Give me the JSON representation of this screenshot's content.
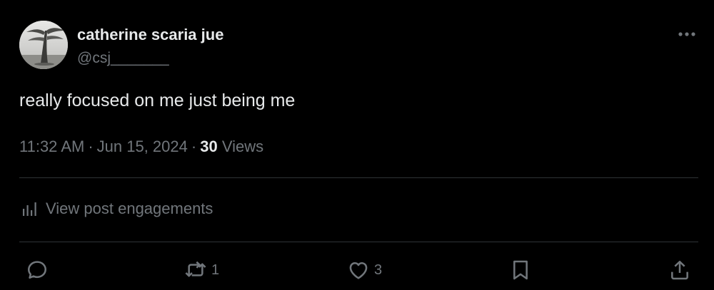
{
  "author": {
    "display_name": "catherine scaria jue",
    "handle": "@csj_______",
    "avatar_icon": "tree-photo-avatar"
  },
  "post": {
    "text": "really focused on me just being me",
    "time": "11:32 AM",
    "separator": "·",
    "date": "Jun 15, 2024",
    "views_count": "30",
    "views_label": "Views"
  },
  "engagements": {
    "label": "View post engagements",
    "icon": "bar-chart-icon"
  },
  "actions": {
    "reply": {
      "icon": "reply-icon",
      "count": ""
    },
    "repost": {
      "icon": "repost-icon",
      "count": "1"
    },
    "like": {
      "icon": "heart-icon",
      "count": "3"
    },
    "bookmark": {
      "icon": "bookmark-icon",
      "count": ""
    },
    "share": {
      "icon": "share-icon",
      "count": ""
    }
  },
  "colors": {
    "background": "#000000",
    "primary_text": "#e7e9ea",
    "secondary_text": "#71767b",
    "divider": "#2f3336"
  }
}
